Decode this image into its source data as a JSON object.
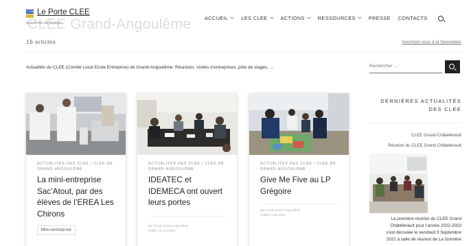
{
  "header": {
    "logo_text": "CLEE",
    "site_name": "Le Porte CLEE",
    "tagline": "Académie de Poitiers",
    "background_title": "CLEE Grand-Angoulême"
  },
  "nav": {
    "items": [
      {
        "label": "ACCUEIL",
        "has_dropdown": true
      },
      {
        "label": "LES CLEE",
        "has_dropdown": true
      },
      {
        "label": "ACTIONS",
        "has_dropdown": true
      },
      {
        "label": "RESSOURCES",
        "has_dropdown": true
      },
      {
        "label": "PRESSE",
        "has_dropdown": false
      },
      {
        "label": "CONTACTS",
        "has_dropdown": false
      }
    ],
    "search_icon": "search-icon"
  },
  "archive": {
    "count": "16 articles",
    "newsletter_link": "Inscrivez-vous à la Newsletter",
    "description": "Actualités du CLEE (Comité Local Ecole Entreprise) de Grand-Angoulême: Réunions, visites d’entreprises, pôle de stages, …"
  },
  "search": {
    "placeholder": "Rechercher …"
  },
  "posts": [
    {
      "category": "ACTUALITÉS DES CLEE / CLEE DE GRAND-ANGOULÊME",
      "title": "La mini-entreprise Sac’Atout, par des élèves de l’EREA Les Chirons",
      "tag": "Mini-entreprise"
    },
    {
      "category": "ACTUALITÉS DES CLEE / CLEE DE GRAND-ANGOULÊME",
      "title": "IDEATEC et IDEMECA ont ouvert leurs portes",
      "author": "par CLEE Grand-Angoulême",
      "date": "Publié 13 mai 2022"
    },
    {
      "category": "ACTUALITÉS DES CLEE / CLEE DE GRAND-ANGOULÊME",
      "title": "Give Me Five au LP Grégoire",
      "author": "par CLEE Grand-Angoulême",
      "date": "Publié 4 mai 2022"
    }
  ],
  "sidebar": {
    "title_line1": "DERNIÈRES ACTUALITÉS",
    "title_line2": "DES CLEE",
    "category_link": "CLEE Grand-Châtellerault",
    "post_link": "Réunion du CLEE Grand Châtellerault",
    "excerpt_lines": [
      "La première réunion du CLEE Grand",
      "Châtellerault pour l’année 2022-2023",
      "s’est déroulée le vendredi 9 Septembre",
      "2022 à salle de réunion de La Gornière"
    ]
  },
  "colors": {
    "logo_blue": "#1a5aa8",
    "logo_yellow": "#e2b53a",
    "search_button": "#222222"
  }
}
